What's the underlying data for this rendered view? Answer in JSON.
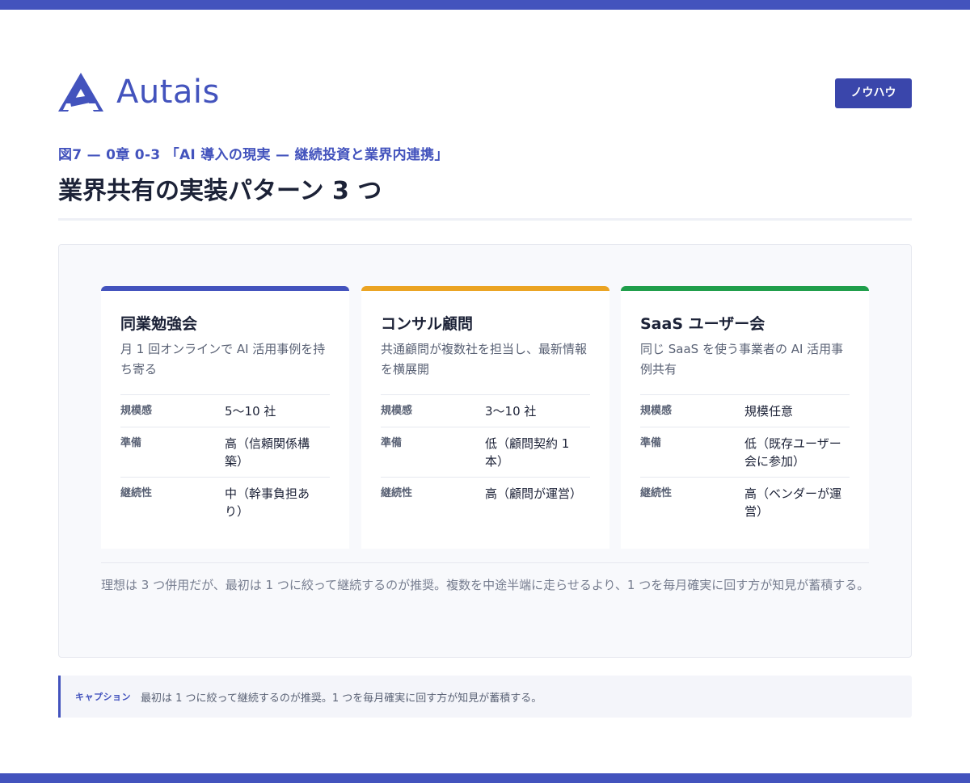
{
  "brand": {
    "name": "Autais",
    "logo_icon": "autais-a-mark-icon",
    "color": "#4353bd"
  },
  "tag": "ノウハウ",
  "eyebrow": "図7 — 0章 0-3 「AI 導入の現実 — 継続投資と業界内連携」",
  "title": "業界共有の実装パターン 3 つ",
  "cards": [
    {
      "title": "同業勉強会",
      "accent": "#4353bd",
      "desc": "月 1 回オンラインで AI 活用事例を持ち寄る",
      "rows": [
        {
          "key": "規模感",
          "value": "5〜10 社"
        },
        {
          "key": "準備",
          "value": "高（信頼関係構築）"
        },
        {
          "key": "継続性",
          "value": "中（幹事負担あり）"
        }
      ]
    },
    {
      "title": "コンサル顧問",
      "accent": "#eba423",
      "desc": "共通顧問が複数社を担当し、最新情報を横展開",
      "rows": [
        {
          "key": "規模感",
          "value": "3〜10 社"
        },
        {
          "key": "準備",
          "value": "低（顧問契約 1 本）"
        },
        {
          "key": "継続性",
          "value": "高（顧問が運営）"
        }
      ]
    },
    {
      "title": "SaaS ユーザー会",
      "accent": "#1f9e4b",
      "desc": "同じ SaaS を使う事業者の AI 活用事例共有",
      "rows": [
        {
          "key": "規模感",
          "value": "規模任意"
        },
        {
          "key": "準備",
          "value": "低（既存ユーザー会に参加）"
        },
        {
          "key": "継続性",
          "value": "高（ベンダーが運営）"
        }
      ]
    }
  ],
  "note": "理想は 3 つ併用だが、最初は 1 つに絞って継続するのが推奨。複数を中途半端に走らせるより、1 つを毎月確実に回す方が知見が蓄積する。",
  "caption": {
    "label": "キャプション",
    "text": "最初は 1 つに絞って継続するのが推奨。1 つを毎月確実に回す方が知見が蓄積する。"
  }
}
